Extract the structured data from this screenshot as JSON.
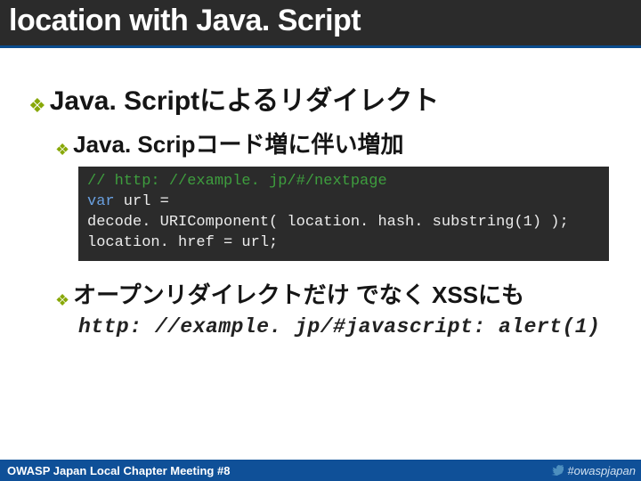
{
  "title": "location with Java. Script",
  "bullet1": "Java. Scriptによるリダイレクト",
  "bullet2": "Java. Scripコード増に伴い増加",
  "code": {
    "l1": "// http: //example. jp/#/nextpage",
    "l2a": "var",
    "l2b": " url =",
    "l3": "    decode. URIComponent( location. hash. substring(1) );",
    "l4": "location. href = url;"
  },
  "bullet3": "オープンリダイレクトだけ でなく XSSにも",
  "xss_url": "http: //example. jp/#javascript: alert(1)",
  "footer_left": "OWASP Japan Local Chapter Meeting #8",
  "footer_right": "#owaspjapan"
}
